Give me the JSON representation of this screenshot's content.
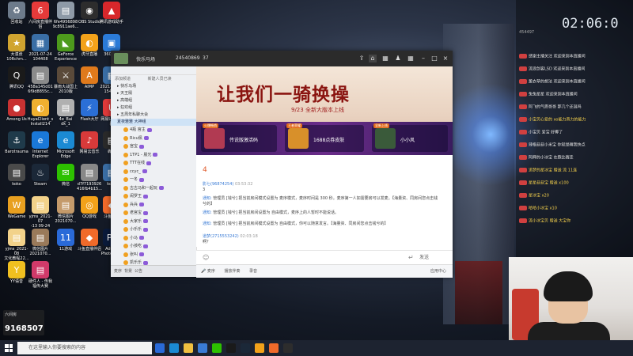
{
  "desktop": {
    "icons": [
      {
        "label": "回收站",
        "color": "#6d7b8b",
        "glyph": "♻"
      },
      {
        "label": "六间房直播伴\n侣",
        "color": "#e53a3a",
        "glyph": "6"
      },
      {
        "label": "6fe4956898\n9c8911ae6...",
        "color": "#8e9aa7",
        "glyph": "▤"
      },
      {
        "label": "OBS Studio",
        "color": "#2d2d2d",
        "glyph": "◉"
      },
      {
        "label": "腾讯游戏助手",
        "color": "#d7272b",
        "glyph": "▲"
      },
      {
        "label": "大漠张\n10Rchm...",
        "color": "#d0a430",
        "glyph": "★"
      },
      {
        "label": "2021-07-24\n104408",
        "color": "#3a6ea5",
        "glyph": "▦"
      },
      {
        "label": "GeForce\nExperience",
        "color": "#4d9a1c",
        "glyph": "◣"
      },
      {
        "label": "虎牙直播",
        "color": "#f3a21a",
        "glyph": "◐"
      },
      {
        "label": "360压缩",
        "color": "#2b7bd8",
        "glyph": "▣"
      },
      {
        "label": "腾讯QQ",
        "color": "#1a1a1a",
        "glyph": "Q"
      },
      {
        "label": "458a145d01\n6f9d8855c...",
        "color": "#8b8b8b",
        "glyph": "▤"
      },
      {
        "label": "暴雨大战国上\n2010版",
        "color": "#5a4a3a",
        "glyph": "⚔"
      },
      {
        "label": "AIMP",
        "color": "#e07a1c",
        "glyph": "A"
      },
      {
        "label": "2021-08-28\n154140",
        "color": "#3a6ea5",
        "glyph": "▦"
      },
      {
        "label": "Among Us",
        "color": "#c83232",
        "glyph": "●"
      },
      {
        "label": "HuyaClient_s\nInstall214",
        "color": "#f0b030",
        "glyph": "◐"
      },
      {
        "label": "4e_Bai\ndk_1",
        "color": "#b0b0b0",
        "glyph": "▤"
      },
      {
        "label": "Flash大厅",
        "color": "#2b6fd6",
        "glyph": "⚡"
      },
      {
        "label": "网易UU加速\n器",
        "color": "#e03a3a",
        "glyph": "U"
      },
      {
        "label": "Barotrauma",
        "color": "#1f3a4a",
        "glyph": "⚓"
      },
      {
        "label": "Internet\nExplorer",
        "color": "#1a78d8",
        "glyph": "e"
      },
      {
        "label": "Microsoft\nEdge",
        "color": "#1b8ad3",
        "glyph": "e"
      },
      {
        "label": "网易云音乐",
        "color": "#d83a3a",
        "glyph": "♪"
      },
      {
        "label": "犇犇",
        "color": "#2a2a2a",
        "glyph": "▤"
      },
      {
        "label": "koko",
        "color": "#4a4a4a",
        "glyph": "▤"
      },
      {
        "label": "Steam",
        "color": "#1b2838",
        "glyph": "♨"
      },
      {
        "label": "微信",
        "color": "#2dc100",
        "glyph": "✉"
      },
      {
        "label": "d7f7193926\n416fb4b15...",
        "color": "#888888",
        "glyph": "▤"
      },
      {
        "label": "koko",
        "color": "#3a6ea5",
        "glyph": "▤"
      },
      {
        "label": "WeGame",
        "color": "#e8a020",
        "glyph": "W"
      },
      {
        "label": "yjms_2021-07\n-13 09-24",
        "color": "#f2d28a",
        "glyph": "▤"
      },
      {
        "label": "微信图片\n2021070...",
        "color": "#c49a6a",
        "glyph": "▤"
      },
      {
        "label": "QQ游戏",
        "color": "#f3a21a",
        "glyph": "◎"
      },
      {
        "label": "斗鱼直播",
        "color": "#f06a2a",
        "glyph": "◆"
      },
      {
        "label": "yjms_2021-08\n文化教程22...",
        "color": "#f2d28a",
        "glyph": "▤"
      },
      {
        "label": "微信图片\n2021070...",
        "color": "#9a7a5a",
        "glyph": "▤"
      },
      {
        "label": "11游戏",
        "color": "#2a6ad8",
        "glyph": "11"
      },
      {
        "label": "斗鱼直播伴侣",
        "color": "#f06a2a",
        "glyph": "◆"
      },
      {
        "label": "Adobe\nPhotoshop",
        "color": "#0a1a3a",
        "glyph": "Ps"
      },
      {
        "label": "YY语音",
        "color": "#f0c020",
        "glyph": "Y"
      },
      {
        "label": "硬件人 - 传我\n福传大赛",
        "color": "#d03a6a",
        "glyph": "▤"
      }
    ]
  },
  "watermark": {
    "brand": "六间房",
    "room": "9168507"
  },
  "client": {
    "room_name": "快乐马场",
    "room_id": "24540869",
    "online_count": "37",
    "sidebar": {
      "sub_left": "添加频道",
      "sub_right": "新建人员已读",
      "channels": [
        "快乐马场",
        "天王殿",
        "高端组",
        "狂欢组",
        "五周年私聊大会"
      ],
      "current_channel": "夏夜雅雅 大神组",
      "users": [
        "4瓶 宫主",
        "Ricu佩",
        "宫宝",
        "1TP1 - 晨光",
        "TTT在线",
        "ccyc_",
        "一冬",
        "古古马和一起玩",
        "闹罗王",
        "兵兵",
        "老宫宝",
        "大家乐",
        "小乐乐",
        "小马",
        "小孩吃",
        "张叫",
        "凯乐乐",
        "微博"
      ],
      "bottom_items": [
        "麦序",
        "背景",
        "公告"
      ]
    },
    "banner": {
      "slogan": "让我们一骑换操",
      "subtitle": "9/23 全新大版本上线",
      "cards": [
        {
          "tag": "火爆畅销",
          "title": "传说版激活码"
        },
        {
          "tag": "王者荣耀",
          "title": "1688点券皮肤"
        },
        {
          "tag": "全新上线",
          "title": "小小风"
        }
      ]
    },
    "chat": {
      "number": "4",
      "messages": [
        {
          "name": "影七(96874254)",
          "time": "03:53:32",
          "text": "3"
        },
        {
          "name": "通知:",
          "time": "",
          "text": "管理员 [钱兮] 把当前房间模式设置为 麦序模式，麦序时间是 300 秒。麦序第一人如需要房可以发麦。【海量资、同房间您点击钱兮的】"
        },
        {
          "name": "通知:",
          "time": "",
          "text": "管理员 [钱兮] 把当前房间设置为 自由模式，麦序上的人暂时不能说话。"
        },
        {
          "name": "通知:",
          "time": "",
          "text": "管理员 [钱兮] 把当前房间模式设置为 自由模式，你可以随意发言。【海量资、同房间您点击钱兮的】"
        },
        {
          "name": "道梦(2715553242)",
          "time": "02:03:18",
          "text": "啊？"
        }
      ],
      "send_label": "发送"
    },
    "bottom_bar": {
      "mic": "麦序",
      "labels": [
        "播放伴奏",
        "录音"
      ],
      "right": "应用中心"
    }
  },
  "overlay": {
    "clock": "02:06:0",
    "id_label": "454497",
    "messages": [
      {
        "level": "2",
        "text": "感谢主播关注 欢迎来到本直播间",
        "highlight": false
      },
      {
        "level": "4",
        "text": "流浪剑客LSD 欢迎来到本直播间",
        "highlight": false
      },
      {
        "level": "3",
        "text": "薰衣草的想法 欢迎来到本直播间",
        "highlight": false
      },
      {
        "level": "5",
        "text": "兔兔星星 欢迎来到本直播间",
        "highlight": false
      },
      {
        "level": "6",
        "text": "阿飞的气质哥哥 那几个还混吗",
        "highlight": false
      },
      {
        "level": "7",
        "text": "小宝贝心爱的 xo能力真力的能力",
        "highlight": true
      },
      {
        "level": "8",
        "text": "小宝贝 爱宝 好椰了",
        "highlight": false
      },
      {
        "level": "9",
        "text": "辣根叔叔小米宝 你就是精我快点",
        "highlight": false
      },
      {
        "level": "10",
        "text": "阿辉的小冰宝 在跑比赛走",
        "highlight": false
      },
      {
        "level": "11",
        "text": "追梦的星冰宝 赠送 流 11连",
        "highlight": true
      },
      {
        "level": "12",
        "text": "星星叔叔宝 赠送 x100",
        "highlight": true
      },
      {
        "level": "13",
        "text": "星冰宝 x20",
        "highlight": true
      },
      {
        "level": "14",
        "text": "哈哈小冰宝 x10",
        "highlight": true
      },
      {
        "level": "15",
        "text": "流小冰宝贝 赠送 大宝你",
        "highlight": true
      }
    ]
  },
  "taskbar": {
    "search_placeholder": "在这里输入你要搜索的内容",
    "apps": [
      "task-view",
      "edge",
      "explorer",
      "store",
      "wechat",
      "qq",
      "steam",
      "huya",
      "douyu",
      "obs"
    ]
  },
  "colors": {
    "accent": "#3a7bd5",
    "brand_red": "#8a1410"
  }
}
